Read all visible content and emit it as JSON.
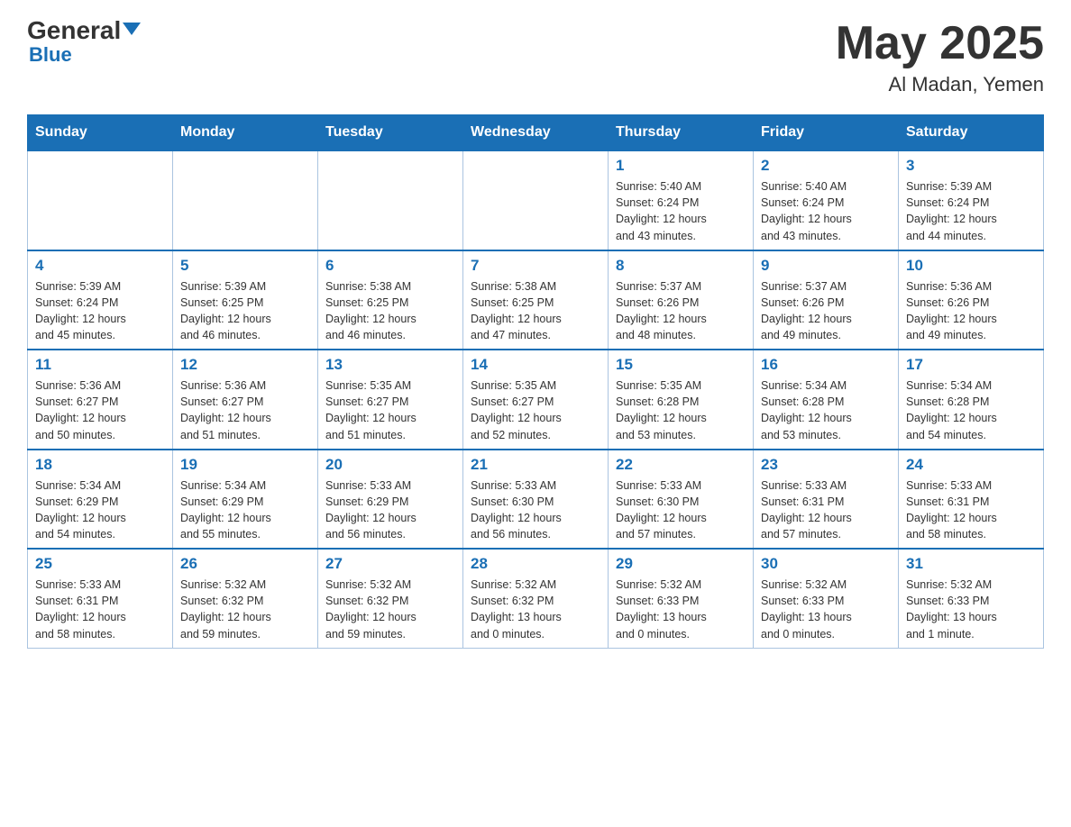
{
  "logo": {
    "general": "General",
    "triangle": "▼",
    "blue": "Blue"
  },
  "title": "May 2025",
  "subtitle": "Al Madan, Yemen",
  "days_of_week": [
    "Sunday",
    "Monday",
    "Tuesday",
    "Wednesday",
    "Thursday",
    "Friday",
    "Saturday"
  ],
  "weeks": [
    [
      {
        "day": "",
        "info": ""
      },
      {
        "day": "",
        "info": ""
      },
      {
        "day": "",
        "info": ""
      },
      {
        "day": "",
        "info": ""
      },
      {
        "day": "1",
        "info": "Sunrise: 5:40 AM\nSunset: 6:24 PM\nDaylight: 12 hours\nand 43 minutes."
      },
      {
        "day": "2",
        "info": "Sunrise: 5:40 AM\nSunset: 6:24 PM\nDaylight: 12 hours\nand 43 minutes."
      },
      {
        "day": "3",
        "info": "Sunrise: 5:39 AM\nSunset: 6:24 PM\nDaylight: 12 hours\nand 44 minutes."
      }
    ],
    [
      {
        "day": "4",
        "info": "Sunrise: 5:39 AM\nSunset: 6:24 PM\nDaylight: 12 hours\nand 45 minutes."
      },
      {
        "day": "5",
        "info": "Sunrise: 5:39 AM\nSunset: 6:25 PM\nDaylight: 12 hours\nand 46 minutes."
      },
      {
        "day": "6",
        "info": "Sunrise: 5:38 AM\nSunset: 6:25 PM\nDaylight: 12 hours\nand 46 minutes."
      },
      {
        "day": "7",
        "info": "Sunrise: 5:38 AM\nSunset: 6:25 PM\nDaylight: 12 hours\nand 47 minutes."
      },
      {
        "day": "8",
        "info": "Sunrise: 5:37 AM\nSunset: 6:26 PM\nDaylight: 12 hours\nand 48 minutes."
      },
      {
        "day": "9",
        "info": "Sunrise: 5:37 AM\nSunset: 6:26 PM\nDaylight: 12 hours\nand 49 minutes."
      },
      {
        "day": "10",
        "info": "Sunrise: 5:36 AM\nSunset: 6:26 PM\nDaylight: 12 hours\nand 49 minutes."
      }
    ],
    [
      {
        "day": "11",
        "info": "Sunrise: 5:36 AM\nSunset: 6:27 PM\nDaylight: 12 hours\nand 50 minutes."
      },
      {
        "day": "12",
        "info": "Sunrise: 5:36 AM\nSunset: 6:27 PM\nDaylight: 12 hours\nand 51 minutes."
      },
      {
        "day": "13",
        "info": "Sunrise: 5:35 AM\nSunset: 6:27 PM\nDaylight: 12 hours\nand 51 minutes."
      },
      {
        "day": "14",
        "info": "Sunrise: 5:35 AM\nSunset: 6:27 PM\nDaylight: 12 hours\nand 52 minutes."
      },
      {
        "day": "15",
        "info": "Sunrise: 5:35 AM\nSunset: 6:28 PM\nDaylight: 12 hours\nand 53 minutes."
      },
      {
        "day": "16",
        "info": "Sunrise: 5:34 AM\nSunset: 6:28 PM\nDaylight: 12 hours\nand 53 minutes."
      },
      {
        "day": "17",
        "info": "Sunrise: 5:34 AM\nSunset: 6:28 PM\nDaylight: 12 hours\nand 54 minutes."
      }
    ],
    [
      {
        "day": "18",
        "info": "Sunrise: 5:34 AM\nSunset: 6:29 PM\nDaylight: 12 hours\nand 54 minutes."
      },
      {
        "day": "19",
        "info": "Sunrise: 5:34 AM\nSunset: 6:29 PM\nDaylight: 12 hours\nand 55 minutes."
      },
      {
        "day": "20",
        "info": "Sunrise: 5:33 AM\nSunset: 6:29 PM\nDaylight: 12 hours\nand 56 minutes."
      },
      {
        "day": "21",
        "info": "Sunrise: 5:33 AM\nSunset: 6:30 PM\nDaylight: 12 hours\nand 56 minutes."
      },
      {
        "day": "22",
        "info": "Sunrise: 5:33 AM\nSunset: 6:30 PM\nDaylight: 12 hours\nand 57 minutes."
      },
      {
        "day": "23",
        "info": "Sunrise: 5:33 AM\nSunset: 6:31 PM\nDaylight: 12 hours\nand 57 minutes."
      },
      {
        "day": "24",
        "info": "Sunrise: 5:33 AM\nSunset: 6:31 PM\nDaylight: 12 hours\nand 58 minutes."
      }
    ],
    [
      {
        "day": "25",
        "info": "Sunrise: 5:33 AM\nSunset: 6:31 PM\nDaylight: 12 hours\nand 58 minutes."
      },
      {
        "day": "26",
        "info": "Sunrise: 5:32 AM\nSunset: 6:32 PM\nDaylight: 12 hours\nand 59 minutes."
      },
      {
        "day": "27",
        "info": "Sunrise: 5:32 AM\nSunset: 6:32 PM\nDaylight: 12 hours\nand 59 minutes."
      },
      {
        "day": "28",
        "info": "Sunrise: 5:32 AM\nSunset: 6:32 PM\nDaylight: 13 hours\nand 0 minutes."
      },
      {
        "day": "29",
        "info": "Sunrise: 5:32 AM\nSunset: 6:33 PM\nDaylight: 13 hours\nand 0 minutes."
      },
      {
        "day": "30",
        "info": "Sunrise: 5:32 AM\nSunset: 6:33 PM\nDaylight: 13 hours\nand 0 minutes."
      },
      {
        "day": "31",
        "info": "Sunrise: 5:32 AM\nSunset: 6:33 PM\nDaylight: 13 hours\nand 1 minute."
      }
    ]
  ]
}
